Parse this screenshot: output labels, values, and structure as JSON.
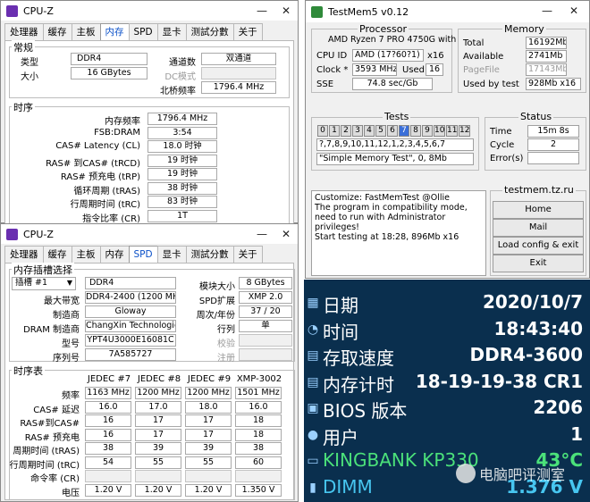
{
  "cpuz1": {
    "title": "CPU-Z",
    "tabs": [
      "处理器",
      "缓存",
      "主板",
      "内存",
      "SPD",
      "显卡",
      "测試分數",
      "关于"
    ],
    "active_tab": 3,
    "general": {
      "title": "常规",
      "type_label": "类型",
      "type_value": "DDR4",
      "size_label": "大小",
      "size_value": "16 GBytes",
      "channel_label": "通道数",
      "channel_value": "双通道",
      "dc_label": "DC模式",
      "dc_value": "",
      "nb_label": "北桥频率",
      "nb_value": "1796.4 MHz"
    },
    "timings": {
      "title": "时序",
      "rows": [
        {
          "label": "内存频率",
          "value": "1796.4 MHz"
        },
        {
          "label": "FSB:DRAM",
          "value": "3:54"
        },
        {
          "label": "CAS# Latency (CL)",
          "value": "18.0 时钟"
        },
        {
          "label": "RAS# 到CAS# (tRCD)",
          "value": "19 时钟"
        },
        {
          "label": "RAS# 预充电 (tRP)",
          "value": "19 时钟"
        },
        {
          "label": "循环周期 (tRAS)",
          "value": "38 时钟"
        },
        {
          "label": "行周期时间 (tRC)",
          "value": "83 时钟"
        },
        {
          "label": "指令比率 (CR)",
          "value": "1T"
        }
      ]
    }
  },
  "cpuz2": {
    "title": "CPU-Z",
    "tabs": [
      "处理器",
      "缓存",
      "主板",
      "内存",
      "SPD",
      "显卡",
      "测試分數",
      "关于"
    ],
    "active_tab": 4,
    "slot": {
      "title": "内存插槽选择",
      "slot_value": "插槽 #1",
      "type_value": "DDR4",
      "module_size_label": "模块大小",
      "module_size_value": "8 GBytes",
      "max_bw_label": "最大带宽",
      "max_bw_value": "DDR4-2400 (1200 MHz)",
      "spd_ext_label": "SPD扩展",
      "spd_ext_value": "XMP 2.0",
      "maker_label": "制造商",
      "maker_value": "Gloway",
      "week_label": "周次/年份",
      "week_value": "37 / 20",
      "dram_label": "DRAM 制造商",
      "dram_value": "ChangXin Technologies",
      "rank_label": "行列",
      "rank_value": "单",
      "part_label": "型号",
      "part_value": "YPT4U3000E16081C",
      "check_label": "校验",
      "check_value": "",
      "serial_label": "序列号",
      "serial_value": "7A585727",
      "reg_label": "注册",
      "reg_value": ""
    },
    "timings_table": {
      "title": "时序表",
      "columns": [
        "JEDEC #7",
        "JEDEC #8",
        "JEDEC #9",
        "XMP-3002"
      ],
      "rows": [
        {
          "label": "频率",
          "values": [
            "1163 MHz",
            "1200 MHz",
            "1200 MHz",
            "1501 MHz"
          ]
        },
        {
          "label": "CAS# 延迟",
          "values": [
            "16.0",
            "17.0",
            "18.0",
            "16.0"
          ]
        },
        {
          "label": "RAS#到CAS#",
          "values": [
            "16",
            "17",
            "17",
            "18"
          ]
        },
        {
          "label": "RAS# 预充电",
          "values": [
            "16",
            "17",
            "17",
            "18"
          ]
        },
        {
          "label": "周期时间 (tRAS)",
          "values": [
            "38",
            "39",
            "39",
            "38"
          ]
        },
        {
          "label": "行周期时间 (tRC)",
          "values": [
            "54",
            "55",
            "55",
            "60"
          ]
        },
        {
          "label": "命令率 (CR)",
          "values": [
            "",
            "",
            "",
            ""
          ]
        },
        {
          "label": "电压",
          "values": [
            "1.20 V",
            "1.20 V",
            "1.20 V",
            "1.350 V"
          ]
        }
      ]
    }
  },
  "testmem": {
    "title": "TestMem5 v0.12",
    "processor": {
      "title": "Processor",
      "name": "AMD Ryzen 7 PRO 4750G with",
      "cpu_id_label": "CPU ID",
      "cpu_id_value": "AMD  (17?60?1)",
      "cpu_id_threads": "x16",
      "clock_label": "Clock *",
      "clock_value": "3593 MHz",
      "used_label": "Used",
      "used_value": "16",
      "sse_label": "SSE",
      "sse_value": "74.8 sec/Gb"
    },
    "memory": {
      "title": "Memory",
      "total_label": "Total",
      "total_value": "16192Mb",
      "available_label": "Available",
      "available_value": "2741Mb",
      "pagefile_label": "PageFile",
      "pagefile_value": "17143Mb",
      "usedby_label": "Used by test",
      "usedby_value": "928Mb x16"
    },
    "tests": {
      "title": "Tests",
      "cells": [
        "0",
        "1",
        "2",
        "3",
        "4",
        "5",
        "6",
        "7",
        "8",
        "9",
        "10",
        "11",
        "12"
      ],
      "active_cell": 7,
      "sequence": "?,7,8,9,10,11,12,1,2,3,4,5,6,7",
      "config": "\"Simple Memory Test\", 0, 8Mb"
    },
    "status": {
      "title": "Status",
      "time_label": "Time",
      "time_value": "15m 8s",
      "cycle_label": "Cycle",
      "cycle_value": "2",
      "errors_label": "Error(s)",
      "errors_value": ""
    },
    "log": [
      "Customize: FastMemTest @Ollie",
      "The program in compatibility mode,",
      "need to run with Administrator privileges!",
      "Start testing at 18:28, 896Mb x16"
    ],
    "site": "testmem.tz.ru",
    "buttons": [
      "Home",
      "Mail",
      "Load config & exit",
      "Exit"
    ]
  },
  "aida": {
    "rows": [
      {
        "label": "日期",
        "value": "2020/10/7",
        "color": "white",
        "icon": "calendar-icon"
      },
      {
        "label": "时间",
        "value": "18:43:40",
        "color": "white",
        "icon": "clock-icon"
      },
      {
        "label": "存取速度",
        "value": "DDR4-3600",
        "color": "white",
        "icon": "memory-module-icon"
      },
      {
        "label": "内存计时",
        "value": "18-19-19-38 CR1",
        "color": "white",
        "icon": "memory-module-icon"
      },
      {
        "label": "BIOS 版本",
        "value": "2206",
        "color": "white",
        "icon": "chip-icon"
      },
      {
        "label": "用户",
        "value": "1",
        "color": "white",
        "icon": "user-icon"
      },
      {
        "label": "KINGBANK KP330",
        "value": "43°C",
        "color": "green",
        "icon": "drive-icon"
      },
      {
        "label": "DIMM",
        "value": "1.376 V",
        "color": "cyan",
        "icon": "voltage-icon"
      }
    ],
    "watermark": "电脑吧评测室"
  },
  "colors": {
    "accent_blue": "#0a50c8",
    "aida_bg": "#0a2f4e",
    "aida_green": "#4be17a",
    "aida_cyan": "#47c6f0",
    "active_cell": "#3b6fd8"
  }
}
